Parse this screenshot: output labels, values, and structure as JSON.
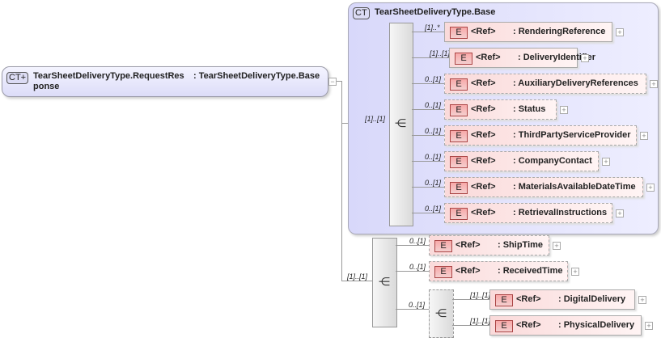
{
  "root": {
    "badge": "CT+",
    "name": "TearSheetDeliveryType.RequestRes",
    "name_wrap": "ponse",
    "type": ": TearSheetDeliveryType.Base",
    "collapse": "−"
  },
  "base": {
    "badge": "CT",
    "title": "TearSheetDeliveryType.Base",
    "cardinality": "[1]..[1]"
  },
  "outer_sequence": {
    "cardinality": "[1]..[1]"
  },
  "choice": {
    "cardinality": "0..[1]"
  },
  "ref_label": "<Ref>",
  "element_badge": "E",
  "expand": "+",
  "base_elements": [
    {
      "name": ": RenderingReference",
      "card": "[1]..*",
      "optional": false,
      "w": 206
    },
    {
      "name": ": DeliveryIdentifier",
      "card": "[1]..[1]",
      "optional": false,
      "w": 157
    },
    {
      "name": ": AuxiliaryDeliveryReferences",
      "card": "0..[1]",
      "optional": true,
      "w": 248
    },
    {
      "name": ": Status",
      "card": "0..[1]",
      "optional": true,
      "w": 137
    },
    {
      "name": ": ThirdPartyServiceProvider",
      "card": "0..[1]",
      "optional": true,
      "w": 236
    },
    {
      "name": ": CompanyContact",
      "card": "0..[1]",
      "optional": true,
      "w": 189
    },
    {
      "name": ": MaterialsAvailableDateTime",
      "card": "0..[1]",
      "optional": true,
      "w": 244
    },
    {
      "name": ": RetrievalInstructions",
      "card": "0..[1]",
      "optional": true,
      "w": 206
    }
  ],
  "outer_elements": [
    {
      "name": ": ShipTime",
      "card": "0..[1]",
      "optional": true,
      "w": 147
    },
    {
      "name": ": ReceivedTime",
      "card": "0..[1]",
      "optional": true,
      "w": 170
    }
  ],
  "choice_elements": [
    {
      "name": ": DigitalDelivery",
      "card": "[1]..[1]",
      "optional": false,
      "w": 178
    },
    {
      "name": ": PhysicalDelivery",
      "card": "[1]..[1]",
      "optional": false,
      "w": 186
    }
  ]
}
